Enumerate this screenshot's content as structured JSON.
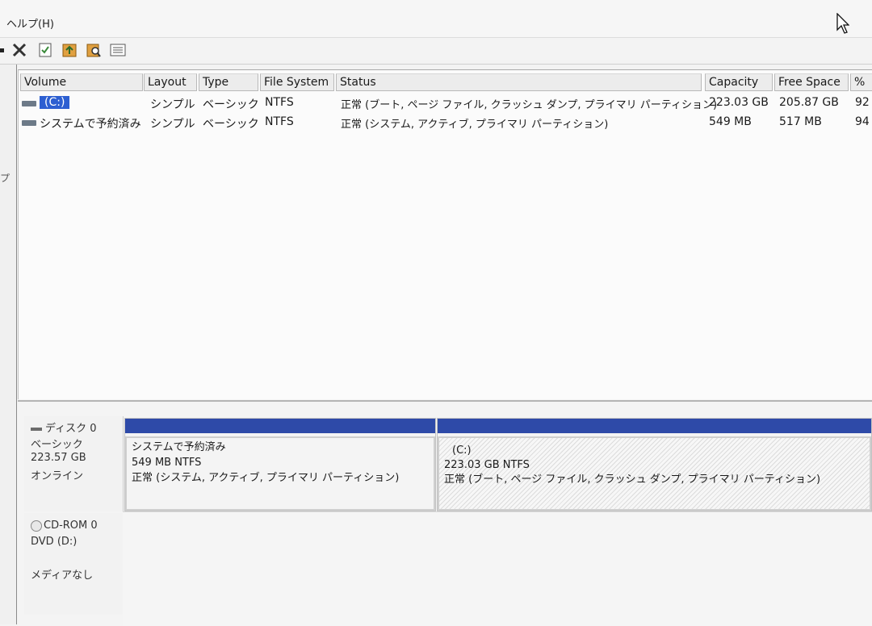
{
  "menu": {
    "help": "ヘルプ(H)"
  },
  "toolbar": {
    "buttons": [
      "close-icon",
      "properties-icon",
      "folder-up-icon",
      "folder-search-icon",
      "list-view-icon"
    ]
  },
  "left_strip": {
    "fragment": "プ"
  },
  "volume_list": {
    "columns": [
      "Volume",
      "Layout",
      "Type",
      "File System",
      "Status",
      "Capacity",
      "Free Space",
      "%"
    ],
    "rows": [
      {
        "volume": "(C:)",
        "layout": "シンプル",
        "type": "ベーシック",
        "fs": "NTFS",
        "status": "正常 (ブート, ページ ファイル, クラッシュ ダンプ, プライマリ パーティション)",
        "capacity": "223.03 GB",
        "free": "205.87 GB",
        "pct": "92"
      },
      {
        "volume": "システムで予約済み",
        "layout": "シンプル",
        "type": "ベーシック",
        "fs": "NTFS",
        "status": "正常 (システム, アクティブ, プライマリ パーティション)",
        "capacity": "549 MB",
        "free": "517 MB",
        "pct": "94"
      }
    ]
  },
  "disks": [
    {
      "name": "ディスク 0",
      "type": "ベーシック",
      "size": "223.57 GB",
      "state": "オンライン",
      "partitions": [
        {
          "name": "システムで予約済み",
          "size_fs": "549 MB NTFS",
          "status": "正常 (システム, アクティブ, プライマリ パーティション)"
        },
        {
          "name": "(C:)",
          "size_fs": "223.03 GB NTFS",
          "status": "正常 (ブート, ページ ファイル, クラッシュ ダンプ, プライマリ パーティション)"
        }
      ]
    },
    {
      "name": "CD-ROM 0",
      "type": "DVD (D:)",
      "media": "メディアなし"
    }
  ],
  "colors": {
    "partition_bar": "#2e4aa8",
    "selection": "#2d5fd1"
  }
}
